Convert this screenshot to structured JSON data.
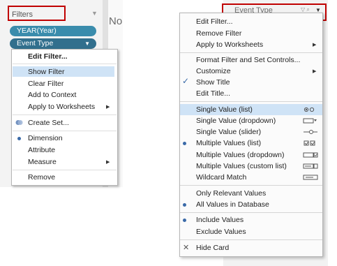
{
  "left_panel": {
    "filters_title": "Filters",
    "canvas_text": "No",
    "pills": [
      {
        "label": "YEAR(Year)"
      },
      {
        "label": "Event Type",
        "caret": "▼"
      }
    ],
    "menu": {
      "edit_filter": "Edit Filter...",
      "show_filter": "Show Filter",
      "clear_filter": "Clear Filter",
      "add_to_context": "Add to Context",
      "apply_to_worksheets": "Apply to Worksheets",
      "create_set": "Create Set...",
      "dimension": "Dimension",
      "attribute": "Attribute",
      "measure": "Measure",
      "remove": "Remove",
      "selected_role": "Dimension",
      "highlighted_item": "Show Filter"
    }
  },
  "right_panel": {
    "card_title": "Event Type",
    "menu": {
      "edit_filter": "Edit Filter...",
      "remove_filter": "Remove Filter",
      "apply_to_worksheets": "Apply to Worksheets",
      "format_filter": "Format Filter and Set Controls...",
      "customize": "Customize",
      "show_title": "Show Title",
      "edit_title": "Edit Title...",
      "single_value_list": "Single Value (list)",
      "single_value_dropdown": "Single Value (dropdown)",
      "single_value_slider": "Single Value (slider)",
      "multiple_values_list": "Multiple Values (list)",
      "multiple_values_dropdown": "Multiple Values (dropdown)",
      "multiple_values_custom": "Multiple Values (custom list)",
      "wildcard_match": "Wildcard Match",
      "only_relevant_values": "Only Relevant Values",
      "all_values_in_database": "All Values in Database",
      "include_values": "Include Values",
      "exclude_values": "Exclude Values",
      "hide_card": "Hide Card",
      "highlighted_item": "Single Value (list)",
      "checked": [
        "Show Title"
      ],
      "selected": [
        "Multiple Values (list)",
        "All Values in Database",
        "Include Values"
      ]
    }
  },
  "colors": {
    "pill": "#3a8cac",
    "highlight": "#cfe3f6",
    "callout_border": "#c00000",
    "selection_dot": "#3a6aa8"
  }
}
